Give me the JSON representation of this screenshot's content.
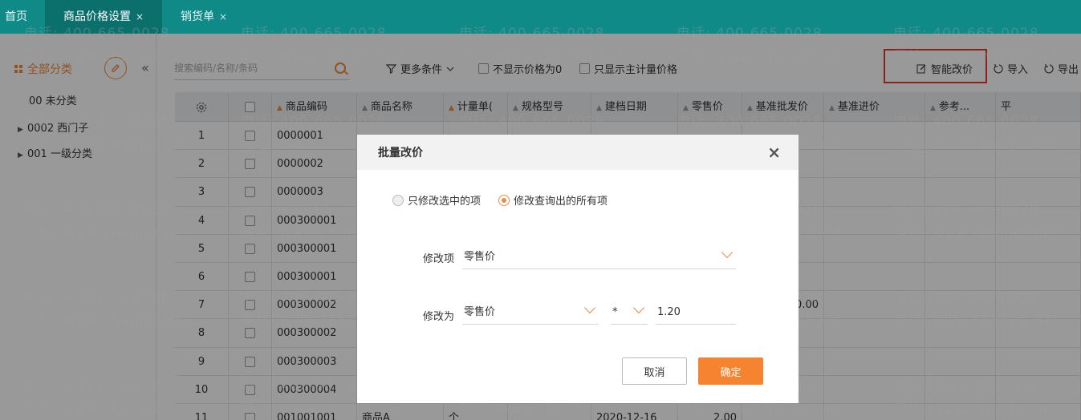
{
  "tabs": [
    {
      "label": "首页"
    },
    {
      "label": "商品价格设置",
      "close": "×"
    },
    {
      "label": "销货单",
      "close": "×"
    }
  ],
  "sidebar": {
    "title": "全部分类",
    "collapse": "«",
    "items": [
      {
        "label": "00 未分类",
        "arrow": ""
      },
      {
        "label": "0002 西门子",
        "arrow": "▶"
      },
      {
        "label": "001 一级分类",
        "arrow": "▶"
      }
    ]
  },
  "toolbar": {
    "search_placeholder": "搜索编码/名称/条码",
    "more_conditions": "更多条件",
    "hide_zero_price": "不显示价格为0",
    "main_unit_only": "只显示主计量价格",
    "smart_price": "智能改价",
    "import": "导入",
    "export": "导出"
  },
  "table": {
    "columns": [
      "",
      "",
      "商品编码",
      "商品名称",
      "计量单(",
      "规格型号",
      "建档日期",
      "零售价",
      "基准批发价",
      "基准进价",
      "参考...",
      "平"
    ],
    "rows": [
      {
        "no": "1",
        "code": "0000001",
        "name": "",
        "unit": "",
        "spec": "",
        "date": "",
        "retail": "",
        "wholesale": "",
        "purchase": ""
      },
      {
        "no": "2",
        "code": "0000002",
        "name": "",
        "unit": "",
        "spec": "",
        "date": "",
        "retail": "",
        "wholesale": "",
        "purchase": ""
      },
      {
        "no": "3",
        "code": "0000003",
        "name": "",
        "unit": "",
        "spec": "",
        "date": "",
        "retail": "",
        "wholesale": "",
        "purchase": ""
      },
      {
        "no": "4",
        "code": "000300001",
        "name": "",
        "unit": "",
        "spec": "",
        "date": "",
        "retail": "",
        "wholesale": "",
        "purchase": ""
      },
      {
        "no": "5",
        "code": "000300001",
        "name": "",
        "unit": "",
        "spec": "",
        "date": "",
        "retail": "",
        "wholesale": "",
        "purchase": ""
      },
      {
        "no": "6",
        "code": "000300001",
        "name": "",
        "unit": "",
        "spec": "",
        "date": "",
        "retail": "",
        "wholesale": "",
        "purchase": ""
      },
      {
        "no": "7",
        "code": "000300002",
        "name": "",
        "unit": "",
        "spec": "",
        "date": "",
        "retail": "",
        "wholesale": "360.00",
        "purchase": ""
      },
      {
        "no": "8",
        "code": "000300002",
        "name": "",
        "unit": "",
        "spec": "",
        "date": "",
        "retail": "",
        "wholesale": "",
        "purchase": ""
      },
      {
        "no": "9",
        "code": "000300003",
        "name": "",
        "unit": "",
        "spec": "",
        "date": "",
        "retail": "",
        "wholesale": "",
        "purchase": ""
      },
      {
        "no": "10",
        "code": "000300004",
        "name": "",
        "unit": "",
        "spec": "",
        "date": "",
        "retail": "",
        "wholesale": "",
        "purchase": ""
      },
      {
        "no": "11",
        "code": "001001001",
        "name": "商品A",
        "unit": "个",
        "spec": "",
        "date": "2020-12-16",
        "retail": "2.00",
        "wholesale": "",
        "purchase": ""
      }
    ]
  },
  "watermark": {
    "phone": "电话: 400-665-0028",
    "site": "网址: www.chanjet.net"
  },
  "dialog": {
    "title": "批量改价",
    "close": "×",
    "radio_selected_only": "只修改选中的项",
    "radio_all_queried": "修改查询出的所有项",
    "modify_item_label": "修改项",
    "modify_item_value": "零售价",
    "modify_to_label": "修改为",
    "modify_to_base": "零售价",
    "modify_to_operator": "*",
    "modify_to_factor": "1.20",
    "cancel": "取消",
    "confirm": "确定"
  },
  "colors": {
    "header_teal": "#0f8a87",
    "accent_orange": "#f5832f",
    "highlight_red": "#e53935"
  }
}
